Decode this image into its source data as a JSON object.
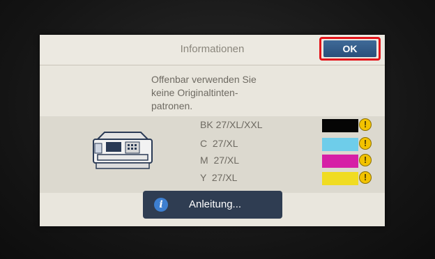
{
  "dialog": {
    "title": "Informationen",
    "ok_label": "OK",
    "message_lines": [
      "Offenbar verwenden Sie",
      "keine Originaltinten-",
      "patronen."
    ]
  },
  "cartridges": [
    {
      "label": "BK 27/XL/XXL",
      "color": "#050505",
      "status": "warning-icon"
    },
    {
      "label": "C  27/XL",
      "color": "#6ecdea",
      "status": "warning-icon"
    },
    {
      "label": "M  27/XL",
      "color": "#d61fa6",
      "status": "warning-icon"
    },
    {
      "label": "Y  27/XL",
      "color": "#f0dc22",
      "status": "warning-icon"
    }
  ],
  "warning_glyph": "!",
  "guide": {
    "icon": "info-icon",
    "icon_glyph": "i",
    "label": "Anleitung..."
  },
  "colors": {
    "ok_button": "#2a4f7a",
    "highlight": "#e3141a",
    "guide_button": "#2f3d52"
  }
}
